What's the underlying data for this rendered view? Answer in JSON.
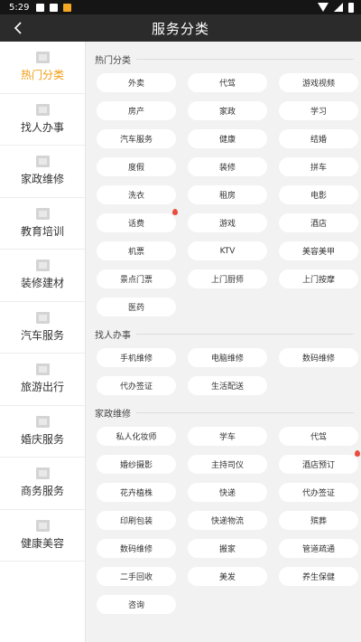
{
  "status": {
    "time": "5:29"
  },
  "header": {
    "title": "服务分类"
  },
  "sidebar": {
    "items": [
      {
        "label": "热门分类",
        "active": true
      },
      {
        "label": "找人办事"
      },
      {
        "label": "家政维修"
      },
      {
        "label": "教育培训"
      },
      {
        "label": "装修建材"
      },
      {
        "label": "汽车服务"
      },
      {
        "label": "旅游出行"
      },
      {
        "label": "婚庆服务"
      },
      {
        "label": "商务服务"
      },
      {
        "label": "健康美容"
      }
    ]
  },
  "sections": [
    {
      "title": "热门分类",
      "items": [
        "外卖",
        "代驾",
        "游戏视频",
        "房产",
        "家政",
        "学习",
        "汽车服务",
        "健康",
        "结婚",
        "度假",
        "装修",
        "拼车",
        "洗衣",
        "租房",
        "电影",
        "话费",
        "游戏",
        "酒店",
        "机票",
        "KTV",
        "美容美甲",
        "景点门票",
        "上门厨师",
        "上门按摩",
        "医药"
      ]
    },
    {
      "title": "找人办事",
      "items": [
        "手机维修",
        "电脑维修",
        "数码维修",
        "代办签证",
        "生活配送"
      ]
    },
    {
      "title": "家政维修",
      "items": [
        "私人化妆师",
        "学车",
        "代驾",
        "婚纱摄影",
        "主持司仪",
        "酒店预订",
        "花卉植株",
        "快递",
        "代办签证",
        "印刷包装",
        "快递物流",
        "殡葬",
        "数码维修",
        "搬家",
        "管道疏通",
        "二手回收",
        "美发",
        "养生保健",
        "咨询"
      ]
    }
  ],
  "hot_flags": {
    "section0_item15": true,
    "section2_item5": true
  }
}
